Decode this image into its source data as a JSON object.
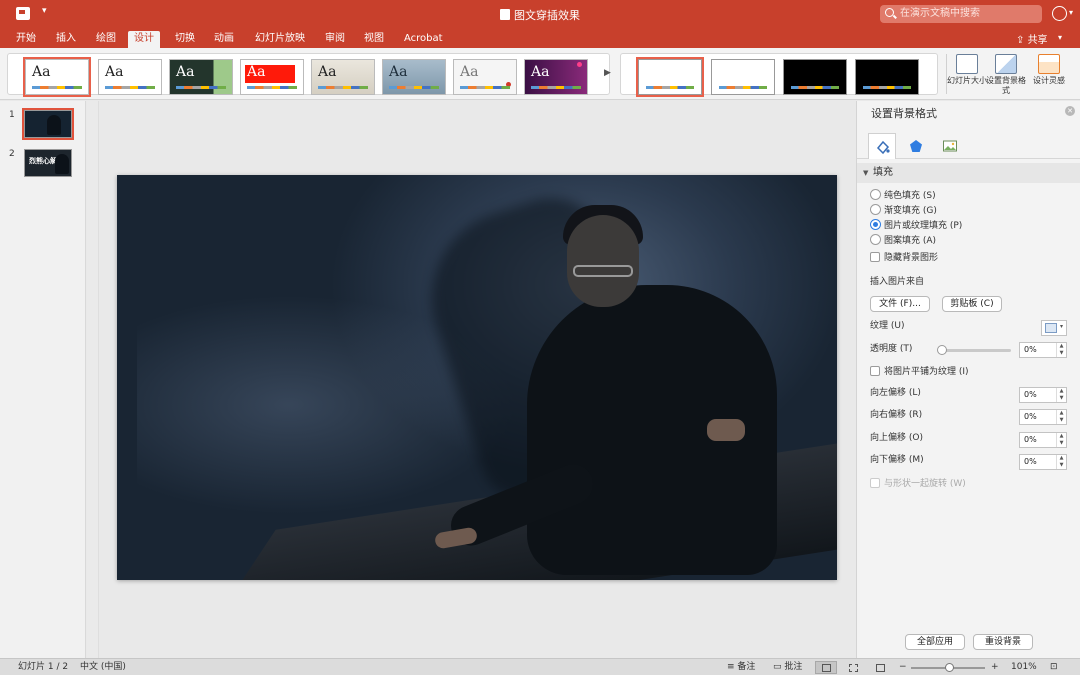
{
  "window": {
    "title": "图文穿插效果",
    "search_placeholder": "在演示文稿中搜索"
  },
  "ribbon_tabs": [
    "开始",
    "插入",
    "绘图",
    "设计",
    "切换",
    "动画",
    "幻灯片放映",
    "审阅",
    "视图",
    "Acrobat"
  ],
  "active_tab": "设计",
  "share_label": "共享",
  "themes": [
    {
      "label": "Aa",
      "bg": "#ffffff",
      "fg": "#333333"
    },
    {
      "label": "Aa",
      "bg": "#ffffff",
      "fg": "#333333"
    },
    {
      "label": "Aa",
      "bg": "#26382f",
      "fg": "#ffffff"
    },
    {
      "label": "Aa",
      "bg": "#ff2a1a",
      "fg": "#ffffff"
    },
    {
      "label": "Aa",
      "bg": "#e3ded4",
      "fg": "#333333"
    },
    {
      "label": "Aa",
      "bg": "#8fa6b8",
      "fg": "#1d2d3a"
    },
    {
      "label": "Aa",
      "bg": "#f4f4f4",
      "fg": "#777777"
    },
    {
      "label": "Aa",
      "bg": "#5a1b58",
      "fg": "#ffffff"
    }
  ],
  "variants": [
    {
      "bg": "#ffffff"
    },
    {
      "bg": "#ffffff"
    },
    {
      "bg": "#000000"
    },
    {
      "bg": "#000000"
    }
  ],
  "ribbon_buttons": {
    "slide_size": "幻灯片大小",
    "format_background": "设置背景格式",
    "design_ideas": "设计灵感"
  },
  "thumbnails": [
    {
      "number": "1",
      "selected": true
    },
    {
      "number": "2",
      "selected": false,
      "text": "烈熊心解"
    }
  ],
  "format_pane": {
    "title": "设置背景格式",
    "section": "填充",
    "fill_options": [
      {
        "label": "纯色填充 (S)",
        "checked": false
      },
      {
        "label": "渐变填充 (G)",
        "checked": false
      },
      {
        "label": "图片或纹理填充 (P)",
        "checked": true
      },
      {
        "label": "图案填充 (A)",
        "checked": false
      }
    ],
    "hide_background_graphics": "隐藏背景图形",
    "insert_from_label": "插入图片来自",
    "file_button": "文件 (F)...",
    "clipboard_button": "剪贴板 (C)",
    "texture_label": "纹理 (U)",
    "transparency_label": "透明度 (T)",
    "transparency_value": "0%",
    "tile_label": "将图片平铺为纹理 (I)",
    "offsets": [
      {
        "label": "向左偏移 (L)",
        "value": "0%"
      },
      {
        "label": "向右偏移 (R)",
        "value": "0%"
      },
      {
        "label": "向上偏移 (O)",
        "value": "0%"
      },
      {
        "label": "向下偏移 (M)",
        "value": "0%"
      }
    ],
    "rotate_with_shape": "与形状一起旋转 (W)",
    "apply_all_button": "全部应用",
    "reset_button": "重设背景"
  },
  "status_bar": {
    "slide_counter": "幻灯片 1 / 2",
    "language": "中文 (中国)",
    "notes": "备注",
    "comments": "批注",
    "zoom_minus": "−",
    "zoom_plus": "+",
    "zoom": "101%"
  },
  "colors": {
    "accent": "#c8402c",
    "selection_outline": "#e0533c",
    "radio_blue": "#2f7de1"
  }
}
